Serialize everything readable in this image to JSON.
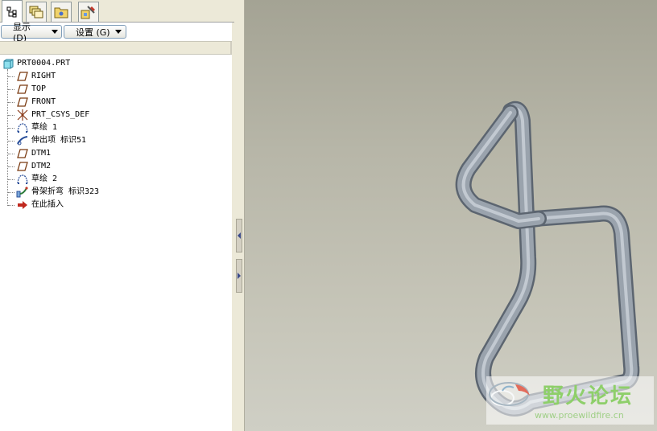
{
  "tabs": [
    {
      "name": "model-tree-tab",
      "icon": "model-tree-icon"
    },
    {
      "name": "layers-tab",
      "icon": "layers-icon"
    },
    {
      "name": "folder-browser-tab",
      "icon": "folder-icon"
    },
    {
      "name": "favorites-tab",
      "icon": "tools-icon"
    }
  ],
  "toolbar": {
    "show_label": "显示 (D)",
    "settings_label": "设置 (G)"
  },
  "tree": {
    "root": "PRT0004.PRT",
    "items": [
      {
        "label": "RIGHT",
        "icon": "datum-plane-icon"
      },
      {
        "label": "TOP",
        "icon": "datum-plane-icon"
      },
      {
        "label": "FRONT",
        "icon": "datum-plane-icon"
      },
      {
        "label": "PRT_CSYS_DEF",
        "icon": "coordinate-system-icon"
      },
      {
        "label": "草绘 1",
        "icon": "sketch-icon"
      },
      {
        "label": "伸出项 标识51",
        "icon": "protrusion-icon"
      },
      {
        "label": "DTM1",
        "icon": "datum-plane-icon"
      },
      {
        "label": "DTM2",
        "icon": "datum-plane-icon"
      },
      {
        "label": "草绘 2",
        "icon": "sketch-icon"
      },
      {
        "label": "骨架折弯 标识323",
        "icon": "spinal-bend-icon"
      },
      {
        "label": "在此插入",
        "icon": "insert-here-arrow-icon"
      }
    ]
  },
  "watermark": {
    "title": "野火论坛",
    "url": "www.proewildfire.cn"
  },
  "colors": {
    "tube": "#8e98a2",
    "viewport_top": "#a4a394",
    "viewport_bottom": "#cfcfc5"
  }
}
